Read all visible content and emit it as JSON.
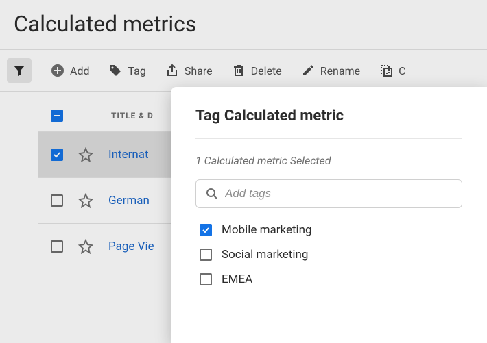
{
  "page": {
    "title": "Calculated metrics"
  },
  "toolbar": {
    "add": "Add",
    "tag": "Tag",
    "share": "Share",
    "delete": "Delete",
    "rename": "Rename",
    "copy": "C"
  },
  "table": {
    "header": {
      "title_col": "Title & D"
    },
    "rows": [
      {
        "title": "Internat",
        "checked": true
      },
      {
        "title": "German",
        "checked": false
      },
      {
        "title": "Page Vie",
        "checked": false
      }
    ]
  },
  "dialog": {
    "title": "Tag Calculated metric",
    "subtitle": "1 Calculated metric Selected",
    "search_placeholder": "Add tags",
    "tags": [
      {
        "label": "Mobile marketing",
        "checked": true
      },
      {
        "label": "Social marketing",
        "checked": false
      },
      {
        "label": "EMEA",
        "checked": false
      }
    ]
  }
}
